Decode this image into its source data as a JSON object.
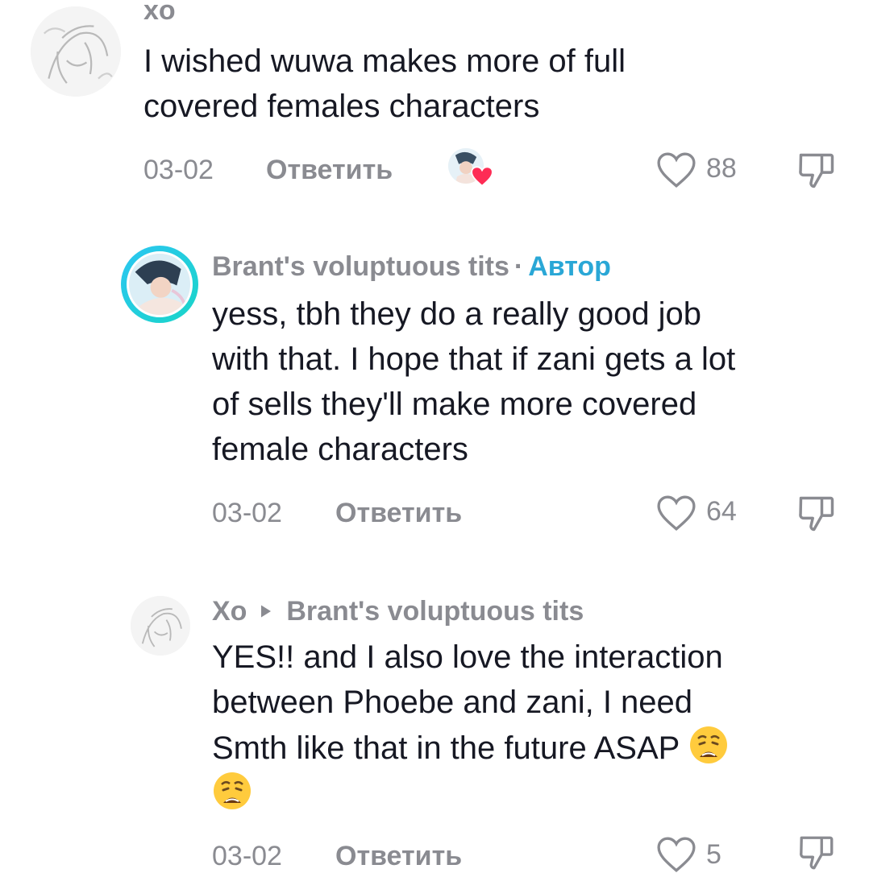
{
  "comments": [
    {
      "username": "xo",
      "text_lines": [
        "I wished wuwa makes more of full",
        "covered females characters"
      ],
      "date": "03-02",
      "reply_label": "Ответить",
      "likes": "88",
      "creator_liked": true
    },
    {
      "username": "Brant's voluptuous tits",
      "author_tag": "Автор",
      "text_lines": [
        "yess, tbh they do a really good job",
        "with that. I hope that if zani gets a lot",
        "of sells they'll make more covered",
        "female characters"
      ],
      "date": "03-02",
      "reply_label": "Ответить",
      "likes": "64"
    },
    {
      "username": "Xo",
      "reply_to": "Brant's voluptuous tits",
      "text_lines": [
        "YES!! and I also love the interaction",
        "between Phoebe and zani, I need",
        "Smth like that in the future ASAP"
      ],
      "date": "03-02",
      "reply_label": "Ответить",
      "likes": "5",
      "emoji": "weary-face"
    }
  ],
  "colors": {
    "author_tag": "#2aa7d6",
    "muted": "#8a8b91",
    "text": "#161823",
    "liked_heart": "#fe2c55"
  }
}
